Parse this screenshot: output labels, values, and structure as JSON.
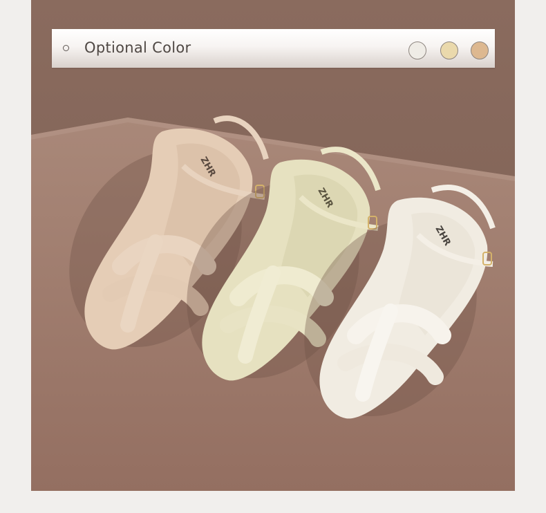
{
  "banner": {
    "title": "Optional Color",
    "swatches": [
      {
        "name": "white",
        "color": "#efece6"
      },
      {
        "name": "cream",
        "color": "#ead9ac"
      },
      {
        "name": "apricot",
        "color": "#ddb890"
      }
    ]
  },
  "product": {
    "brand_on_insole": "ZHR",
    "sandals": [
      {
        "name": "apricot",
        "color": "#e5cdb6"
      },
      {
        "name": "cream",
        "color": "#e6e1c0"
      },
      {
        "name": "white",
        "color": "#f1ece2"
      }
    ]
  },
  "colors": {
    "backdrop": "#8a6b5e",
    "surface": "#a07d6f"
  }
}
